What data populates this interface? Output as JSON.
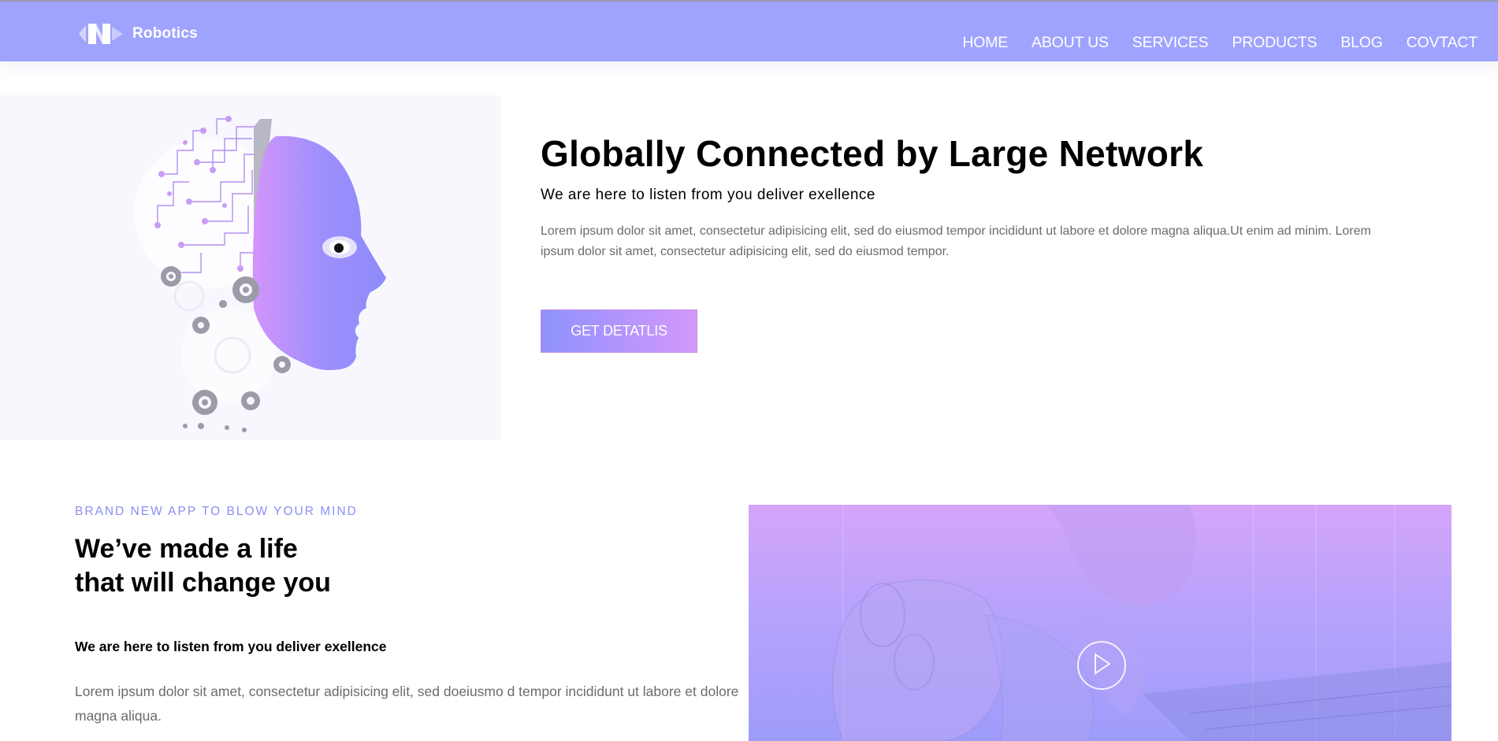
{
  "brand": {
    "name": "Robotics"
  },
  "nav": {
    "items": [
      {
        "label": "HOME"
      },
      {
        "label": "ABOUT US"
      },
      {
        "label": "SERVICES"
      },
      {
        "label": "PRODUCTS"
      },
      {
        "label": "BLOG"
      },
      {
        "label": "COVTACT"
      }
    ]
  },
  "hero": {
    "title": "Globally Connected by Large Network",
    "subtitle": "We are here to listen from you deliver exellence",
    "text": "Lorem ipsum dolor sit amet, consectetur adipisicing elit, sed do eiusmod tempor incididunt ut labore et dolore magna aliqua.Ut enim ad minim. Lorem ipsum dolor sit amet, consectetur adipisicing elit, sed do eiusmod tempor.",
    "button_label": "GET DETATLIS",
    "image_icon": "robot-head-illustration"
  },
  "about": {
    "eyebrow": "BRAND NEW APP TO BLOW YOUR MIND",
    "title_line1": "We’ve made a life",
    "title_line2": "that will change you",
    "subtitle": "We are here to listen from you deliver exellence",
    "text": "Lorem ipsum dolor sit amet, consectetur adipisicing elit, sed doeiusmo d tempor incididunt ut labore et dolore magna aliqua.",
    "video_icon": "play-icon"
  },
  "colors": {
    "header": "#9fa3fe",
    "accent": "#8b8ff0",
    "gradient_start": "#8f92fc",
    "gradient_end": "#d398fb"
  }
}
